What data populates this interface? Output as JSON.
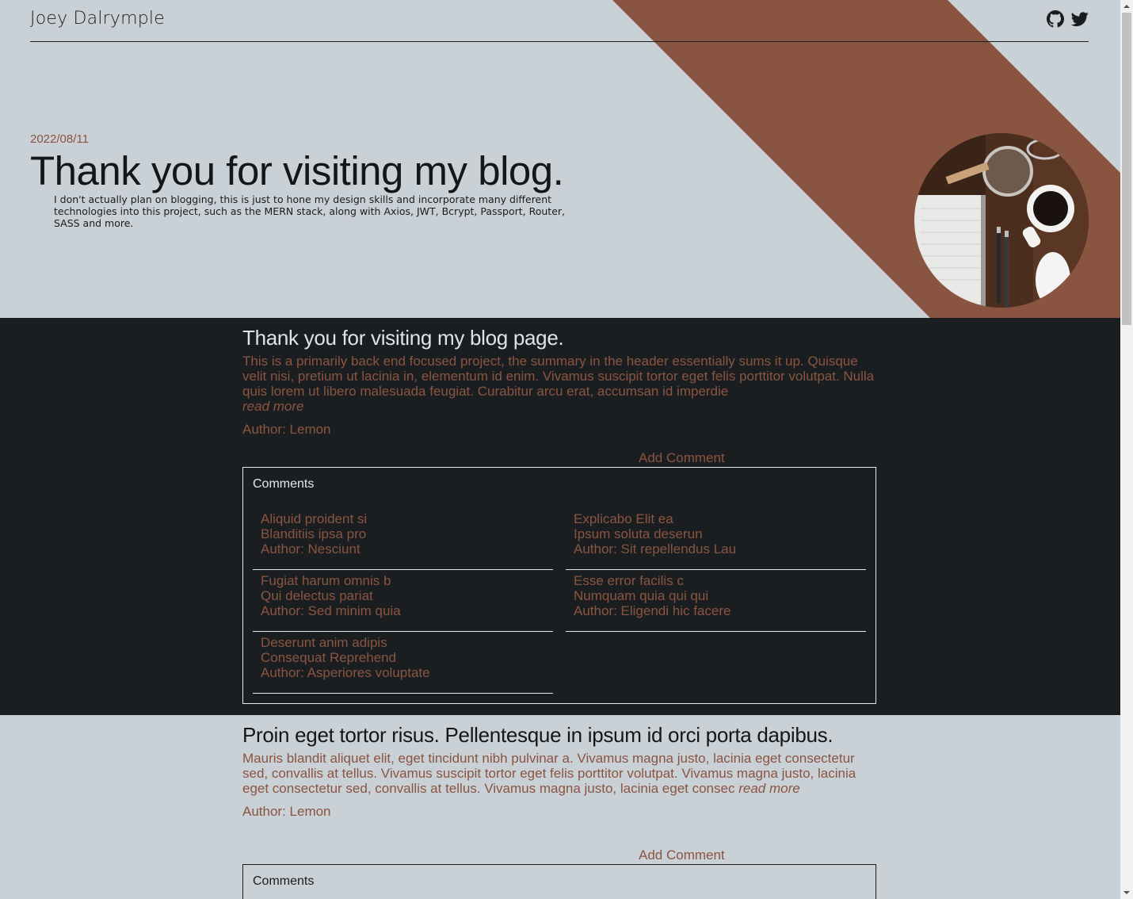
{
  "header": {
    "site_name": "Joey Dalrymple",
    "icons": [
      "github-icon",
      "twitter-icon"
    ]
  },
  "hero": {
    "date": "2022/08/11",
    "title": "Thank you for visiting my blog.",
    "description": "I don't actually plan on blogging, this is just to hone my design skills and incorporate many different technologies into this project, such as the MERN stack, along with Axios, JWT, Bcrypt, Passport, Router, SASS and more."
  },
  "posts": [
    {
      "title": "Thank you for visiting my blog page.",
      "summary": "This is a primarily back end focused project, the summary in the header essentially sums it up. Quisque velit nisi, pretium ut lacinia in, elementum id enim. Vivamus suscipit tortor eget felis porttitor volutpat. Nulla quis lorem ut libero malesuada feugiat. Curabitur arcu erat, accumsan id imperdie",
      "read_more": "read more",
      "author": "Author: Lemon",
      "add_comment": "Add Comment",
      "comments_title": "Comments",
      "comments": [
        {
          "title": "Aliquid proident si",
          "body": "Blanditiis ipsa pro",
          "author": "Author: Nesciunt"
        },
        {
          "title": "Explicabo Elit ea",
          "body": "Ipsum soluta deserun",
          "author": "Author: Sit repellendus Lau"
        },
        {
          "title": "Fugiat harum omnis b",
          "body": "Qui delectus pariat",
          "author": "Author: Sed minim quia"
        },
        {
          "title": "Esse error facilis c",
          "body": "Numquam quia qui qui",
          "author": "Author: Eligendi hic facere"
        },
        {
          "title": "Deserunt anim adipis",
          "body": "Consequat Reprehend",
          "author": "Author: Asperiores voluptate"
        }
      ]
    },
    {
      "title": "Proin eget tortor risus. Pellentesque in ipsum id orci porta dapibus.",
      "summary": "Mauris blandit aliquet elit, eget tincidunt nibh pulvinar a. Vivamus magna justo, lacinia eget consectetur sed, convallis at tellus. Vivamus suscipit tortor eget felis porttitor volutpat. Vivamus magna justo, lacinia eget consectetur sed, convallis at tellus. Vivamus magna justo, lacinia eget consec",
      "read_more": "read more",
      "author": "Author: Lemon",
      "add_comment": "Add Comment",
      "comments_title": "Comments"
    }
  ],
  "colors": {
    "light_bg": "#c9d0d6",
    "dark_bg": "#1b1e21",
    "accent": "#8a5540"
  }
}
